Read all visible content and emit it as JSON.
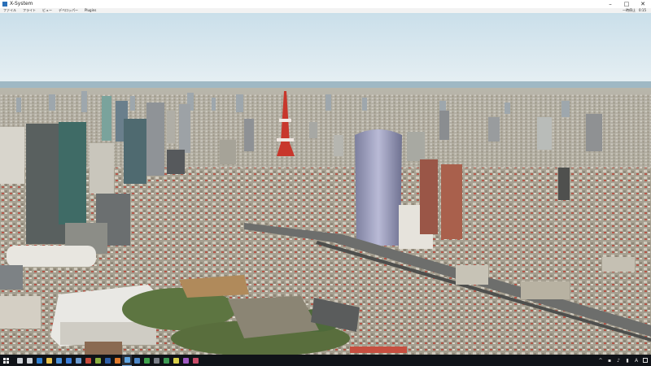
{
  "window": {
    "title": "X-System",
    "minimize_icon": "minimize-icon",
    "maximize_icon": "maximize-icon",
    "close_icon": "close-icon"
  },
  "menu": {
    "items": [
      {
        "label": "ファイル"
      },
      {
        "label": "フライト"
      },
      {
        "label": "ビュー"
      },
      {
        "label": "デベロッパー"
      },
      {
        "label": "Plugins"
      }
    ],
    "right_status": [
      "一時停止",
      "0:15"
    ]
  },
  "scene": {
    "description_icon": "aerial-city-view",
    "sky_top": "#cfe2ec",
    "sky_bottom": "#e4eef2",
    "sea": "#7ea0b3",
    "ground": "#a59f8f"
  },
  "taskbar": {
    "start_icon": "windows-start-icon",
    "apps": [
      {
        "icon": "search-icon",
        "color": "#cfd3d8"
      },
      {
        "icon": "task-view-icon",
        "color": "#cfd3d8"
      },
      {
        "icon": "edge-icon",
        "color": "#2f7fd1"
      },
      {
        "icon": "folder-icon",
        "color": "#e8c14b"
      },
      {
        "icon": "store-icon",
        "color": "#4a90d9"
      },
      {
        "icon": "mail-icon",
        "color": "#3b7dd8"
      },
      {
        "icon": "app-icon",
        "color": "#6b9bd1"
      },
      {
        "icon": "app-icon",
        "color": "#c84a3a"
      },
      {
        "icon": "app-icon",
        "color": "#8bb040"
      },
      {
        "icon": "app-icon",
        "color": "#2e5fa8"
      },
      {
        "icon": "app-icon",
        "color": "#e07a2d"
      },
      {
        "icon": "xplane-icon",
        "color": "#5fa4e0",
        "active": true
      },
      {
        "icon": "app-icon",
        "color": "#4d87c7"
      },
      {
        "icon": "app-icon",
        "color": "#3fa34d"
      },
      {
        "icon": "app-icon",
        "color": "#7a7f89"
      },
      {
        "icon": "chrome-icon",
        "color": "#3d9b53"
      },
      {
        "icon": "app-icon",
        "color": "#d8d04a"
      },
      {
        "icon": "app-icon",
        "color": "#a05ac2"
      },
      {
        "icon": "app-icon",
        "color": "#c94d6a"
      }
    ],
    "tray": [
      "chevron-up-icon",
      "network-icon",
      "speaker-icon",
      "battery-icon",
      "ime-icon",
      "notification-icon"
    ],
    "tray_text": [
      "^",
      "▪",
      "♪",
      "▮",
      "A"
    ]
  }
}
